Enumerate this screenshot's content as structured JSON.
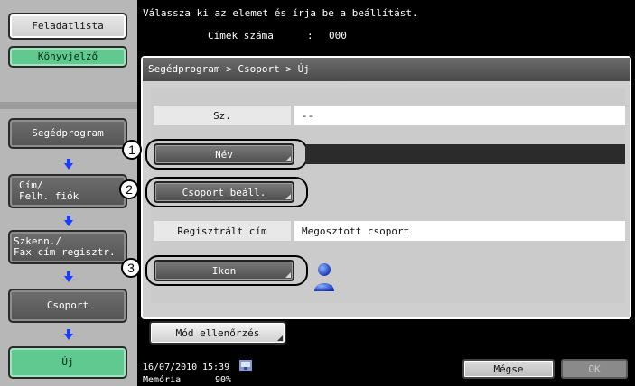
{
  "sidebar": {
    "feladatlista": "Feladatlista",
    "konyvjelzo": "Könyvjelző",
    "segedprogram": "Segédprogram",
    "cim_line1": "Cím/",
    "cim_line2": "Felh. fiók",
    "szkenn_line1": "Szkenn./",
    "szkenn_line2": "Fax cím regisztr.",
    "csoport": "Csoport",
    "uj": "Új"
  },
  "header": {
    "instruction": "Válassza ki az elemet és írja be a beállítást.",
    "count_label": "Címek száma",
    "count_colon": ":",
    "count_value": "000"
  },
  "breadcrumb": "Segédprogram > Csoport > Új",
  "form": {
    "sz_label": "Sz.",
    "sz_value": "--",
    "nev_button": "Név",
    "csoport_button": "Csoport beáll.",
    "reg_label": "Regisztrált cím",
    "reg_value": "Megosztott csoport",
    "ikon_button": "Ikon",
    "mod_button": "Mód ellenőrzés"
  },
  "callouts": [
    "1",
    "2",
    "3"
  ],
  "footer": {
    "date": "16/07/2010",
    "time": "15:39",
    "memory_label": "Memória",
    "memory_value": "90%",
    "cancel": "Mégse",
    "ok": "OK"
  },
  "icons": {
    "group_icon": "user-person-icon",
    "network_icon": "network-icon"
  },
  "colors": {
    "green": "#5fc98f",
    "arrow_blue": "#1a3cff",
    "header_black": "#000000",
    "panel_gray": "#cfcfcf"
  }
}
